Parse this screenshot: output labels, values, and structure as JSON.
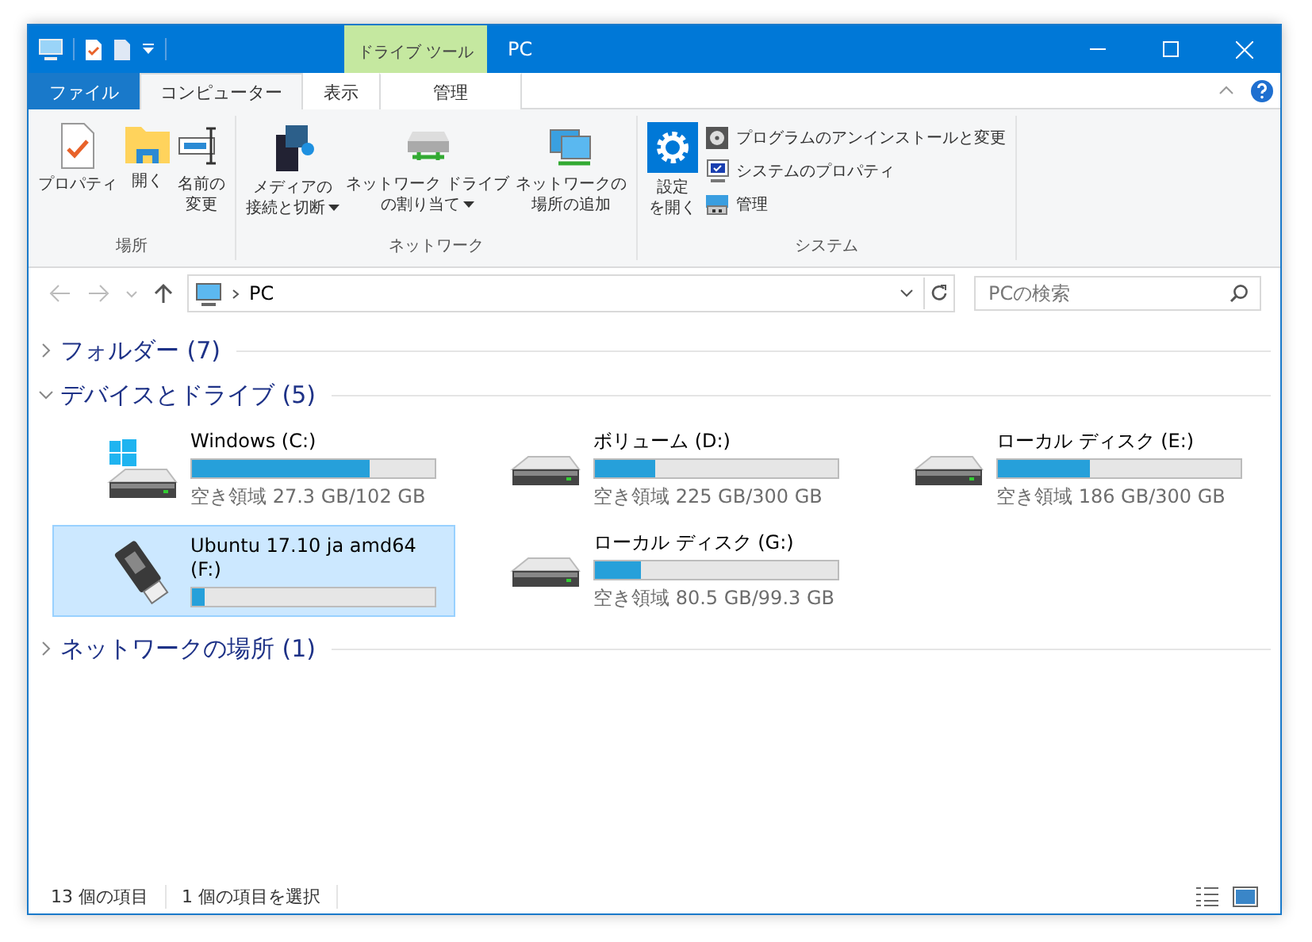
{
  "window": {
    "title": "PC",
    "context_tab": "ドライブ ツール"
  },
  "ribbon_tabs": [
    {
      "label": "ファイル",
      "kind": "file",
      "selected": false
    },
    {
      "label": "コンピューター",
      "kind": "normal",
      "selected": true
    },
    {
      "label": "表示",
      "kind": "normal",
      "selected": false
    },
    {
      "label": "管理",
      "kind": "context",
      "selected": false
    }
  ],
  "ribbon_groups": [
    {
      "label": "場所",
      "large_buttons": [
        {
          "lines": [
            "プロパティ"
          ],
          "dropdown": false
        },
        {
          "lines": [
            "開く"
          ],
          "dropdown": false
        },
        {
          "lines": [
            "名前の",
            "変更"
          ],
          "dropdown": false
        }
      ]
    },
    {
      "label": "ネットワーク",
      "large_buttons": [
        {
          "lines": [
            "メディアの",
            "接続と切断"
          ],
          "dropdown": true
        },
        {
          "lines": [
            "ネットワーク ドライブ",
            "の割り当て"
          ],
          "dropdown": true
        },
        {
          "lines": [
            "ネットワークの",
            "場所の追加"
          ],
          "dropdown": false
        }
      ]
    },
    {
      "label": "システム",
      "large_buttons": [
        {
          "lines": [
            "設定",
            "を開く"
          ],
          "dropdown": false
        }
      ],
      "small_buttons": [
        {
          "label": "プログラムのアンインストールと変更"
        },
        {
          "label": "システムのプロパティ"
        },
        {
          "label": "管理"
        }
      ]
    }
  ],
  "address": {
    "path": "PC"
  },
  "search": {
    "placeholder": "PCの検索"
  },
  "groups": [
    {
      "title": "フォルダー (7)",
      "expanded": false
    },
    {
      "title": "デバイスとドライブ (5)",
      "expanded": true,
      "drives": [
        {
          "name": "Windows (C:)",
          "kind": "windows",
          "level": 0.73,
          "free": "空き領域 27.3 GB/102 GB",
          "selected": false
        },
        {
          "name": "ボリューム (D:)",
          "kind": "hdd",
          "level": 0.25,
          "free": "空き領域 225 GB/300 GB",
          "selected": false
        },
        {
          "name": "ローカル ディスク (E:)",
          "kind": "hdd",
          "level": 0.38,
          "free": "空き領域 186 GB/300 GB",
          "selected": false
        },
        {
          "name": "Ubuntu 17.10 ja amd64 (F:)",
          "kind": "usb",
          "level": 0.05,
          "selected": true
        },
        {
          "name": "ローカル ディスク (G:)",
          "kind": "hdd",
          "level": 0.19,
          "free": "空き領域 80.5 GB/99.3 GB",
          "selected": false
        }
      ]
    },
    {
      "title": "ネットワークの場所 (1)",
      "expanded": false
    }
  ],
  "status_bar": {
    "items": [
      "13 個の項目",
      "1 個の項目を選択"
    ]
  }
}
